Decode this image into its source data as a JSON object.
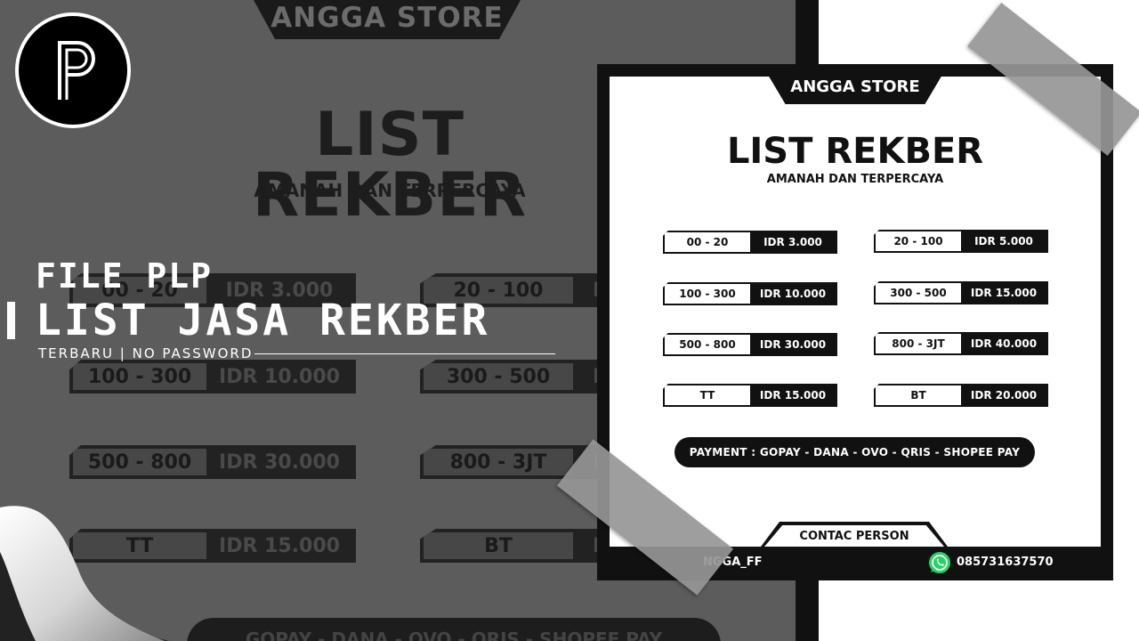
{
  "background": {
    "header": "ANGGA STORE",
    "title": "LIST REKBER",
    "subtitle": "AMANAH DAN TERPERCAYA",
    "rates": [
      {
        "range": "00 - 20",
        "price": "IDR 3.000"
      },
      {
        "range": "20 - 100",
        "price": "ID"
      },
      {
        "range": "100 - 300",
        "price": "IDR 10.000"
      },
      {
        "range": "300 - 500",
        "price": "ID"
      },
      {
        "range": "500 - 800",
        "price": "IDR 30.000"
      },
      {
        "range": "800 - 3JT",
        "price": "ID"
      },
      {
        "range": "TT",
        "price": "IDR 15.000"
      },
      {
        "range": "BT",
        "price": "ID"
      }
    ],
    "payment": "GOPAY - DANA - OVO - QRIS - SHOPEE PAY"
  },
  "overlay": {
    "logo_letter": "P",
    "line1": "FILE PLP",
    "line2": "LIST JASA REKBER",
    "line3": "TERBARU | NO PASSWORD"
  },
  "card": {
    "header": "ANGGA STORE",
    "title": "LIST REKBER",
    "subtitle": "AMANAH DAN TERPERCAYA",
    "rates": [
      {
        "range": "00 - 20",
        "price": "IDR 3.000"
      },
      {
        "range": "20 - 100",
        "price": "IDR 5.000"
      },
      {
        "range": "100 - 300",
        "price": "IDR 10.000"
      },
      {
        "range": "300 - 500",
        "price": "IDR 15.000"
      },
      {
        "range": "500 - 800",
        "price": "IDR 30.000"
      },
      {
        "range": "800 - 3JT",
        "price": "IDR 40.000"
      },
      {
        "range": "TT",
        "price": "IDR 15.000"
      },
      {
        "range": "BT",
        "price": "IDR 20.000"
      }
    ],
    "payment": "PAYMENT : GOPAY - DANA - OVO - QRIS - SHOPEE PAY",
    "contact_label": "CONTAC PERSON",
    "contact_name": "NGGA_FF",
    "contact_phone": "085731637570",
    "contact_icon": "whatsapp-icon"
  },
  "colors": {
    "background_poster": "#5c5c5c",
    "dark": "#111111",
    "light": "#ffffff",
    "tape": "#969696",
    "whatsapp_green": "#25d366"
  }
}
